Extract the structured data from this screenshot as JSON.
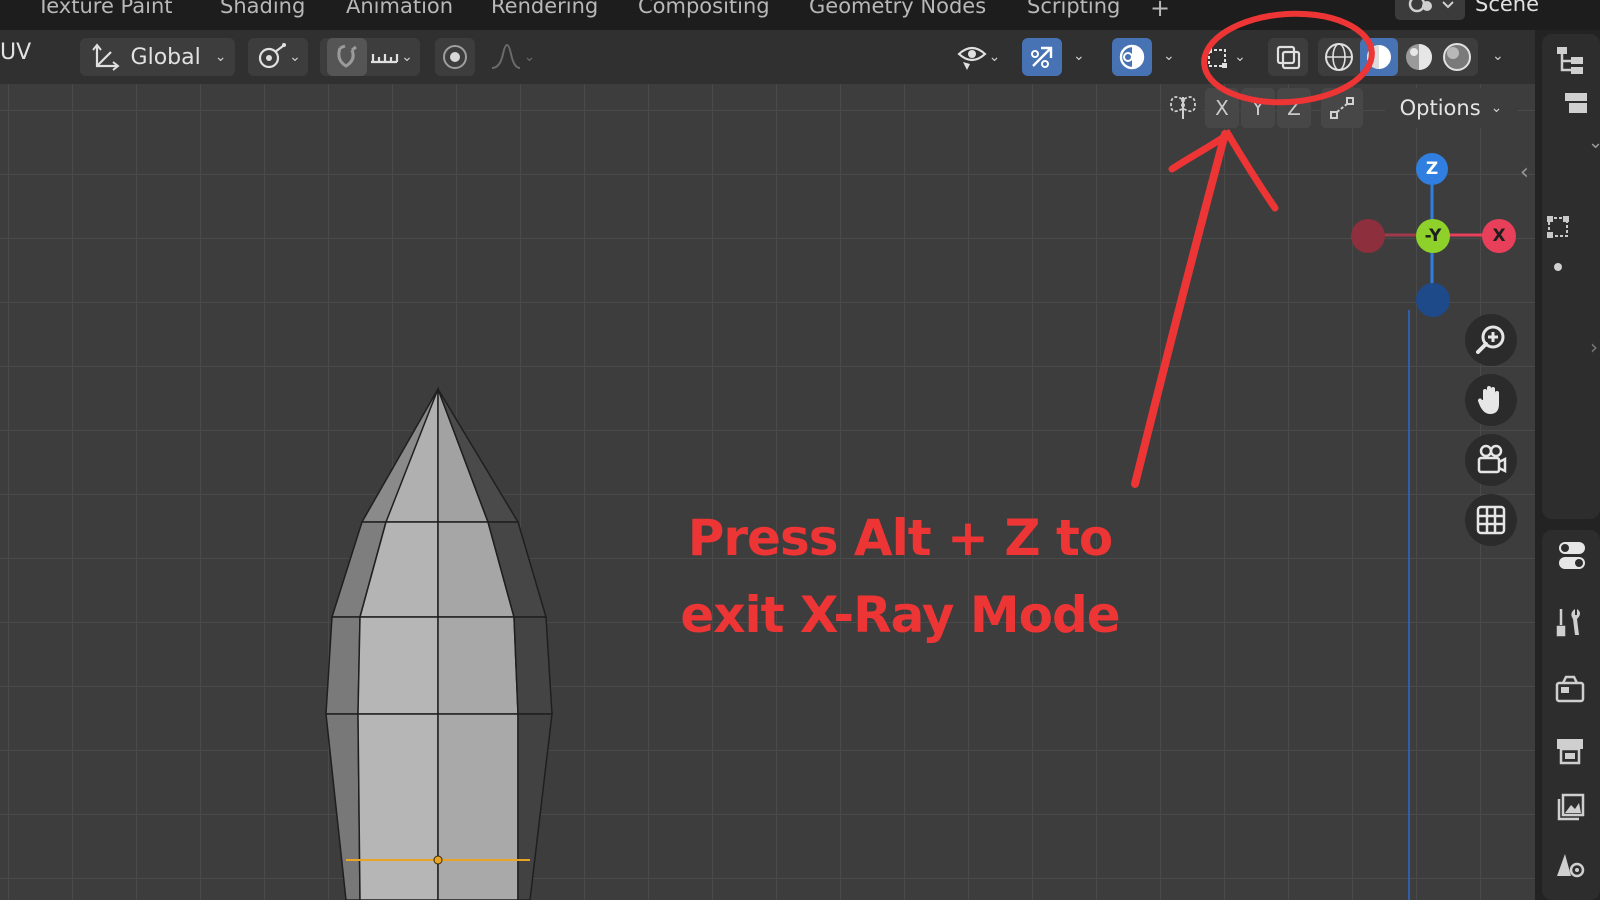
{
  "workspace_tabs": [
    "Texture Paint",
    "Shading",
    "Animation",
    "Rendering",
    "Compositing",
    "Geometry Nodes",
    "Scripting"
  ],
  "scene_label": "Scene",
  "header": {
    "mode_label": "UV",
    "orientation_label": "Global"
  },
  "subbar": {
    "axis_x": "X",
    "axis_y": "Y",
    "axis_z": "Z",
    "options_label": "Options"
  },
  "gizmo": {
    "z_label": "Z",
    "neg_y_label": "-Y",
    "x_label": "X"
  },
  "annotation": {
    "line1": "Press Alt + Z to",
    "line2": "exit X-Ray Mode"
  },
  "colors": {
    "accent_blue": "#4772b3",
    "annotation_red": "#ee3535",
    "axis_x": "#e8405a",
    "axis_y": "#8fd12b",
    "axis_z": "#2f7ee0",
    "selection_orange": "#e8a424"
  },
  "icons": {
    "orientation": "transform-orientation-icon",
    "pivot": "pivot-point-icon",
    "snap": "snap-magnet-icon",
    "proportional": "proportional-editing-icon",
    "visibility": "eye-icon",
    "gizmo": "gizmo-icon",
    "overlay": "overlay-icon",
    "xray": "xray-toggle-icon",
    "shading": [
      "wireframe-shading-icon",
      "solid-shading-icon",
      "material-shading-icon",
      "rendered-shading-icon"
    ]
  }
}
